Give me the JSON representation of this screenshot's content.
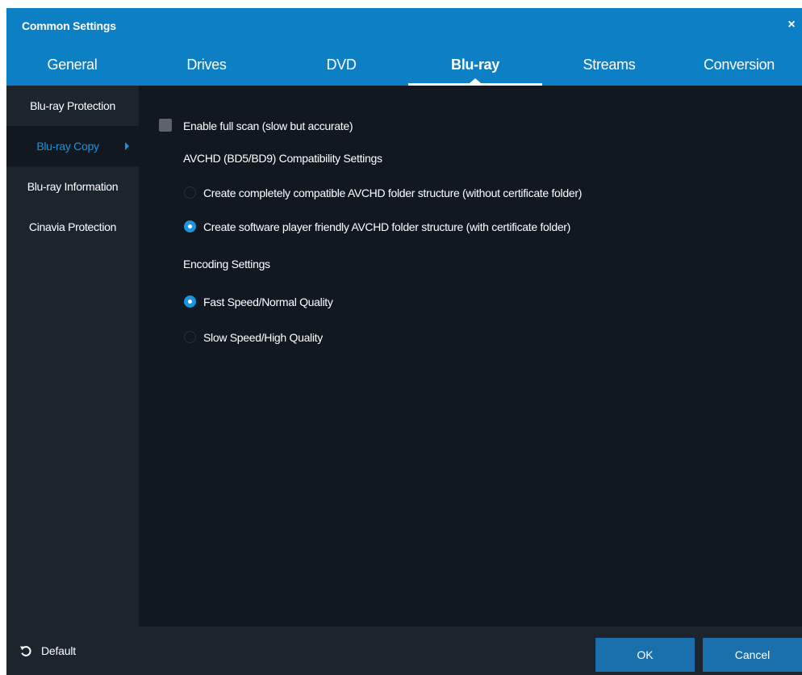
{
  "window": {
    "title": "Common Settings",
    "close_glyph": "×",
    "accent_color": "#0d7fc5"
  },
  "tabs": [
    {
      "label": "General",
      "active": false
    },
    {
      "label": "Drives",
      "active": false
    },
    {
      "label": "DVD",
      "active": false
    },
    {
      "label": "Blu-ray",
      "active": true
    },
    {
      "label": "Streams",
      "active": false
    },
    {
      "label": "Conversion",
      "active": false
    }
  ],
  "sidebar": {
    "items": [
      {
        "label": "Blu-ray Protection",
        "active": false
      },
      {
        "label": "Blu-ray Copy",
        "active": true
      },
      {
        "label": "Blu-ray Information",
        "active": false
      },
      {
        "label": "Cinavia Protection",
        "active": false
      }
    ]
  },
  "content": {
    "full_scan": {
      "label": "Enable full scan (slow but accurate)",
      "checked": false
    },
    "avchd": {
      "heading": "AVCHD (BD5/BD9) Compatibility Settings",
      "options": [
        {
          "label": "Create completely compatible AVCHD folder structure (without certificate folder)",
          "selected": false
        },
        {
          "label": "Create software player friendly AVCHD folder structure (with certificate folder)",
          "selected": true
        }
      ]
    },
    "encoding": {
      "heading": "Encoding Settings",
      "options": [
        {
          "label": "Fast Speed/Normal Quality",
          "selected": true
        },
        {
          "label": "Slow Speed/High Quality",
          "selected": false
        }
      ]
    }
  },
  "footer": {
    "default_label": "Default",
    "default_icon": "undo-icon",
    "ok_label": "OK",
    "cancel_label": "Cancel"
  }
}
